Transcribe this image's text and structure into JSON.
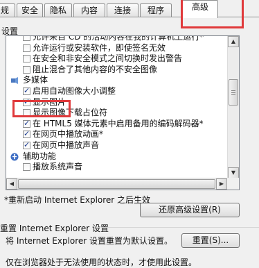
{
  "tabs": [
    "规",
    "安全",
    "隐私",
    "内容",
    "连接",
    "程序",
    "高级"
  ],
  "active_tab": "高级",
  "section_label": "设置",
  "tree": [
    {
      "type": "check",
      "checked": false,
      "label": "允许来自 CD 的活动内容在我的计算机上运行*"
    },
    {
      "type": "check",
      "checked": false,
      "label": "允许运行或安装软件，即使签名无效"
    },
    {
      "type": "check",
      "checked": false,
      "label": "在安全和非安全模式之间切换时发出警告"
    },
    {
      "type": "check",
      "checked": false,
      "label": "阻止混合了其他内容的不安全图像"
    },
    {
      "type": "category",
      "icon": "multimedia-icon",
      "label": "多媒体"
    },
    {
      "type": "check",
      "checked": true,
      "label": "启用自动图像大小调整"
    },
    {
      "type": "check",
      "checked": true,
      "label": "显示图片"
    },
    {
      "type": "check",
      "checked": false,
      "label": "显示图像下载占位符"
    },
    {
      "type": "check",
      "checked": true,
      "label": "在 HTML5 媒体元素中启用备用的编码解码器*"
    },
    {
      "type": "check",
      "checked": true,
      "label": "在网页中播放动画*"
    },
    {
      "type": "check",
      "checked": true,
      "label": "在网页中播放声音"
    },
    {
      "type": "category",
      "icon": "accessibility-icon",
      "label": "辅助功能"
    },
    {
      "type": "check",
      "checked": false,
      "label": "播放系统声音"
    }
  ],
  "restart_note": "*重新启动 Internet Explorer 之后生效",
  "restore_button": "还原高级设置(R)",
  "reset_group_title": "重置 Internet Explorer 设置",
  "reset_description": "将 Internet Explorer 设置重置为默认设置。",
  "reset_button": "重置(S)...",
  "bottom_text": "仅在浏览器处于无法使用的状态时，才使用此设置。"
}
